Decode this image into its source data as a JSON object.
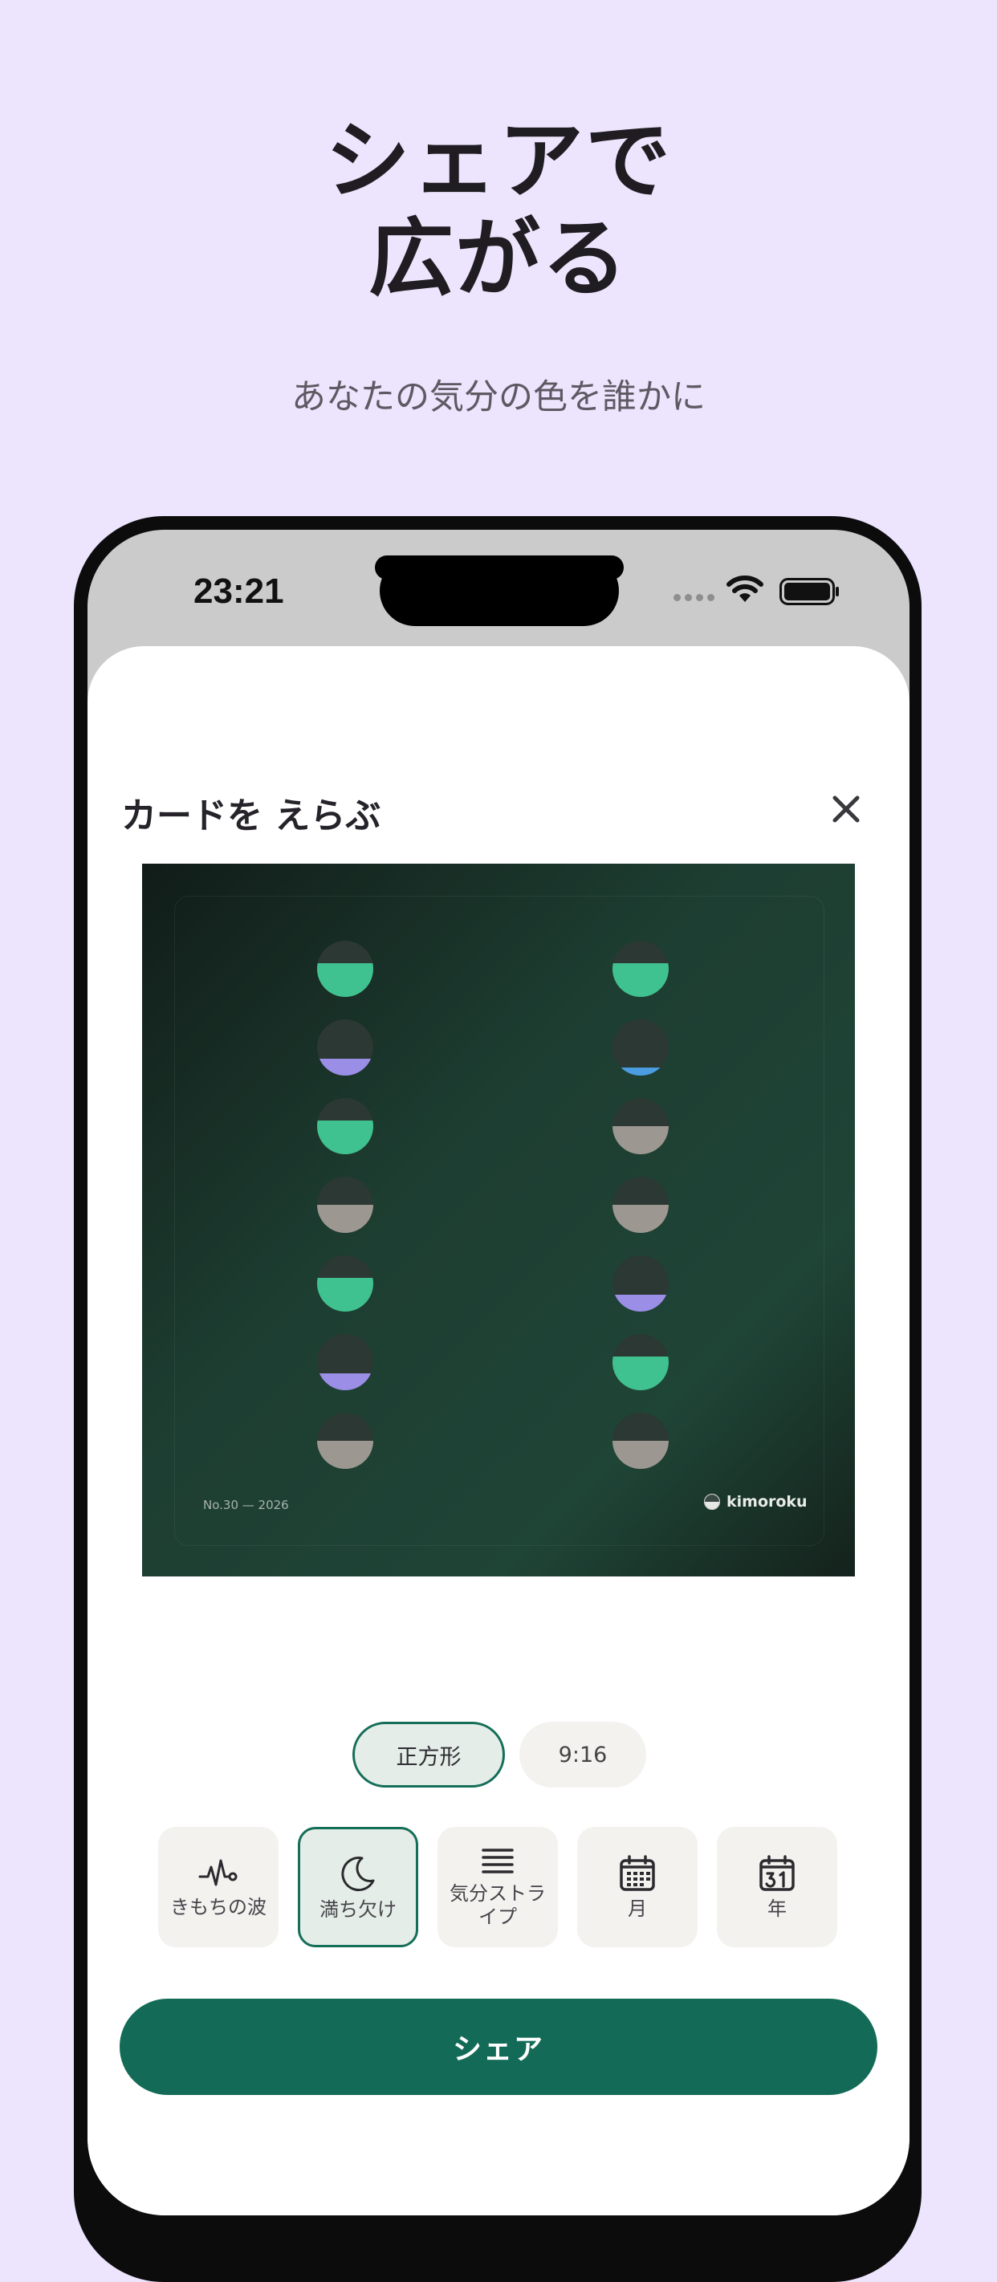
{
  "hero": {
    "title_line1": "シェアで",
    "title_line2": "広がる",
    "subtitle": "あなたの気分の色を誰かに"
  },
  "status_bar": {
    "time": "23:21"
  },
  "sheet": {
    "title": "カードを えらぶ",
    "close_icon": "close-icon"
  },
  "card": {
    "footer_left": "No.30 — 2026",
    "brand": "kimoroku",
    "colors": {
      "green": "#40c290",
      "purple": "#9b8ee6",
      "gray": "#9c9790",
      "blue": "#4a9de0",
      "empty": "#2b3833"
    },
    "columns": [
      [
        {
          "color": "green",
          "fill": 0.6
        },
        {
          "color": "purple",
          "fill": 0.3
        },
        {
          "color": "green",
          "fill": 0.6
        },
        {
          "color": "gray",
          "fill": 0.5
        },
        {
          "color": "green",
          "fill": 0.6
        },
        {
          "color": "purple",
          "fill": 0.3
        },
        {
          "color": "gray",
          "fill": 0.5
        }
      ],
      [
        {
          "color": "green",
          "fill": 0.6
        },
        {
          "color": "blue",
          "fill": 0.15
        },
        {
          "color": "gray",
          "fill": 0.5
        },
        {
          "color": "gray",
          "fill": 0.5
        },
        {
          "color": "purple",
          "fill": 0.3
        },
        {
          "color": "green",
          "fill": 0.6
        },
        {
          "color": "gray",
          "fill": 0.5
        }
      ]
    ]
  },
  "format": {
    "square_label": "正方形",
    "story_label": "9:16",
    "selected": "正方形"
  },
  "styles": [
    {
      "label": "きもちの波",
      "icon": "heartbeat-wave-icon"
    },
    {
      "label": "満ち欠け",
      "icon": "moon-icon"
    },
    {
      "label": "気分ストラ\nイプ",
      "icon": "stripes-icon"
    },
    {
      "label": "月",
      "icon": "calendar-grid-icon"
    },
    {
      "label": "年",
      "icon": "calendar-31-icon"
    }
  ],
  "selected_style": "満ち欠け",
  "share_label": "シェア",
  "accent": "#136b57",
  "background": "#ede4fd"
}
